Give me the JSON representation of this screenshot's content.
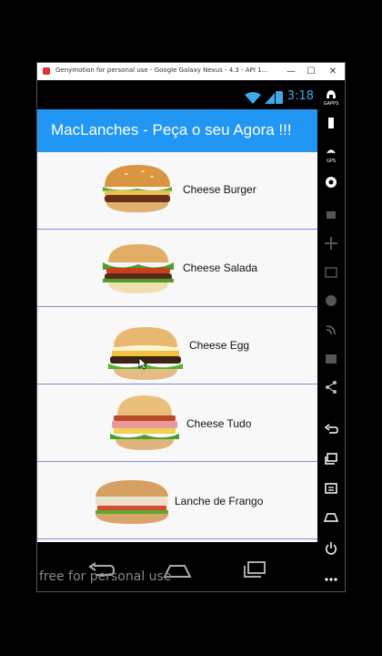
{
  "window": {
    "title": "Genymotion for personal use - Google Galaxy Nexus - 4.3 - API 1...",
    "minimize": "—",
    "maximize": "☐",
    "close": "✕"
  },
  "status": {
    "time": "3:18"
  },
  "app": {
    "title": "MacLanches - Peça o seu Agora !!!"
  },
  "items": [
    {
      "label": "Cheese Burger"
    },
    {
      "label": "Cheese Salada"
    },
    {
      "label": "Cheese Egg"
    },
    {
      "label": "Cheese Tudo"
    },
    {
      "label": "Lanche de Frango"
    }
  ],
  "watermark": "free for personal use",
  "sidebar": {
    "gapps": "GAPPS",
    "gps": "GPS"
  }
}
